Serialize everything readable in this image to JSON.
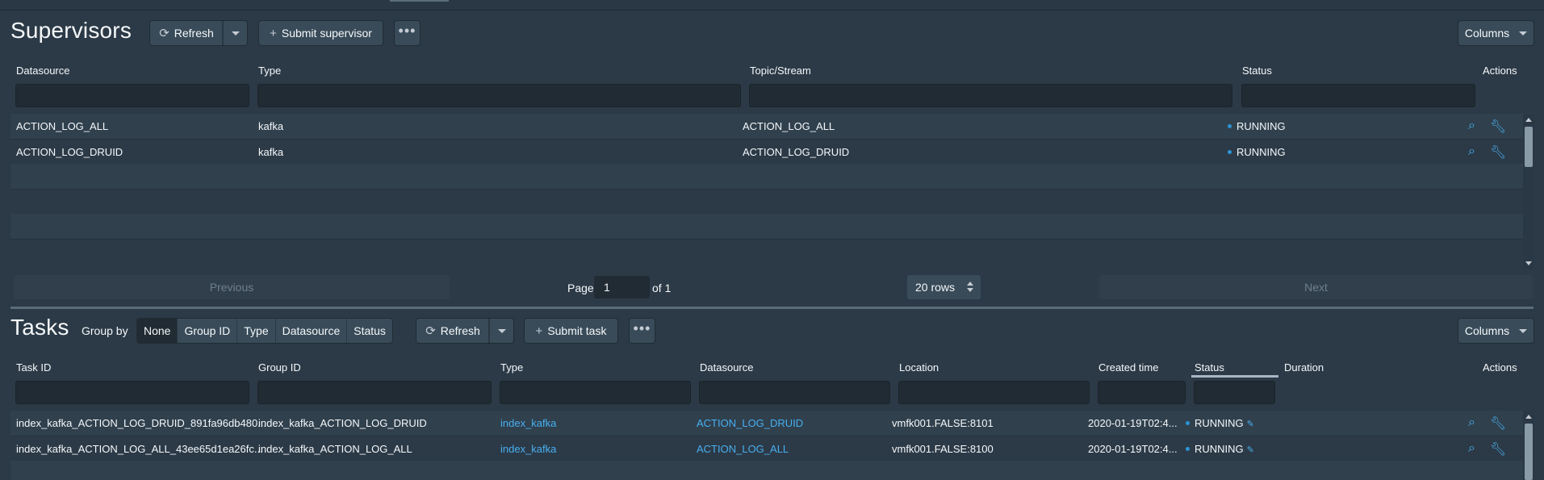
{
  "supervisors": {
    "title": "Supervisors",
    "refresh_label": "Refresh",
    "submit_label": "Submit supervisor",
    "more_label": "•••",
    "columns_label": "Columns",
    "columns": [
      "Datasource",
      "Type",
      "Topic/Stream",
      "Status",
      "Actions"
    ],
    "rows": [
      {
        "datasource": "ACTION_LOG_ALL",
        "type": "kafka",
        "topic": "ACTION_LOG_ALL",
        "status": "RUNNING"
      },
      {
        "datasource": "ACTION_LOG_DRUID",
        "type": "kafka",
        "topic": "ACTION_LOG_DRUID",
        "status": "RUNNING"
      }
    ],
    "pager": {
      "previous_label": "Previous",
      "page_label": "Page",
      "page_value": "1",
      "of_label": "of 1",
      "rows_label": "20 rows",
      "next_label": "Next"
    }
  },
  "tasks": {
    "title": "Tasks",
    "group_by_label": "Group by",
    "group_options": [
      "None",
      "Group ID",
      "Type",
      "Datasource",
      "Status"
    ],
    "group_selected": "None",
    "refresh_label": "Refresh",
    "submit_label": "Submit task",
    "more_label": "•••",
    "columns_label": "Columns",
    "columns": [
      "Task ID",
      "Group ID",
      "Type",
      "Datasource",
      "Location",
      "Created time",
      "Status",
      "Duration",
      "Actions"
    ],
    "rows": [
      {
        "task_id": "index_kafka_ACTION_LOG_DRUID_891fa96db480...",
        "group_id": "index_kafka_ACTION_LOG_DRUID",
        "type": "index_kafka",
        "datasource": "ACTION_LOG_DRUID",
        "location": "vmfk001.FALSE:8101",
        "created": "2020-01-19T02:4...",
        "status": "RUNNING"
      },
      {
        "task_id": "index_kafka_ACTION_LOG_ALL_43ee65d1ea26fc...",
        "group_id": "index_kafka_ACTION_LOG_ALL",
        "type": "index_kafka",
        "datasource": "ACTION_LOG_ALL",
        "location": "vmfk001.FALSE:8100",
        "created": "2020-01-19T02:4...",
        "status": "RUNNING"
      }
    ]
  },
  "icons": {
    "refresh": "refresh-icon",
    "plus": "plus-icon",
    "caret": "caret-down-icon",
    "more": "more-icon",
    "inspect": "search-icon",
    "actions": "wrench-icon",
    "edit": "edit-icon"
  },
  "colors": {
    "background": "#2c3a47",
    "link": "#48aff0",
    "status_dot": "#2b95d6"
  }
}
